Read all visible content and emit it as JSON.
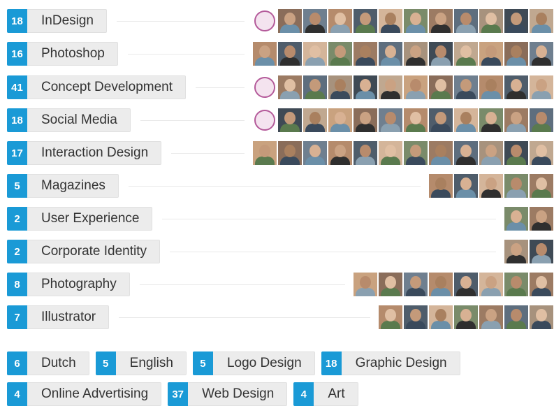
{
  "skills": [
    {
      "count": "18",
      "label": "InDesign",
      "avatars": 12,
      "ring": true
    },
    {
      "count": "16",
      "label": "Photoshop",
      "avatars": 12,
      "ring": false
    },
    {
      "count": "41",
      "label": "Concept Development",
      "avatars": 12,
      "ring": true
    },
    {
      "count": "18",
      "label": "Social Media",
      "avatars": 12,
      "ring": true
    },
    {
      "count": "17",
      "label": "Interaction Design",
      "avatars": 12,
      "ring": false
    },
    {
      "count": "5",
      "label": "Magazines",
      "avatars": 5,
      "ring": false
    },
    {
      "count": "2",
      "label": "User Experience",
      "avatars": 2,
      "ring": false
    },
    {
      "count": "2",
      "label": "Corporate Identity",
      "avatars": 2,
      "ring": false
    },
    {
      "count": "8",
      "label": "Photography",
      "avatars": 8,
      "ring": false
    },
    {
      "count": "7",
      "label": "Illustrator",
      "avatars": 7,
      "ring": false
    }
  ],
  "tags_row1": [
    {
      "count": "6",
      "label": "Dutch"
    },
    {
      "count": "5",
      "label": "English"
    },
    {
      "count": "5",
      "label": "Logo Design"
    },
    {
      "count": "18",
      "label": "Graphic Design"
    }
  ],
  "tags_row2": [
    {
      "count": "4",
      "label": "Online Advertising"
    },
    {
      "count": "37",
      "label": "Web Design"
    },
    {
      "count": "4",
      "label": "Art"
    }
  ],
  "colors": {
    "accent": "#1a9ad6",
    "pill_bg": "#ececec"
  }
}
